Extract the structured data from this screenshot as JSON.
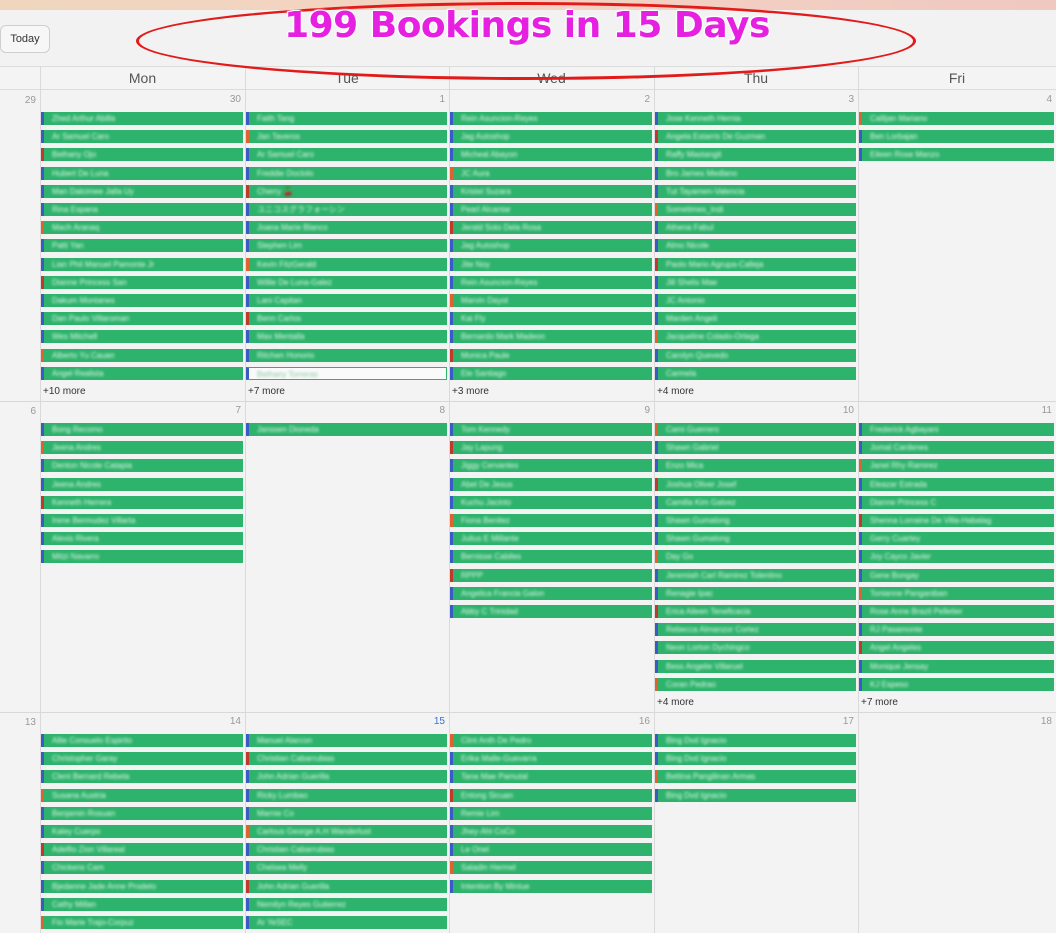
{
  "headline": "199 Bookings in 15 Days",
  "toolbar": {
    "today_label": "Today"
  },
  "weekdays": [
    "Mon",
    "Tue",
    "Wed",
    "Thu",
    "Fri"
  ],
  "colors": {
    "event_green": "#2db36b",
    "annotation_red": "#e21a1a",
    "headline_magenta": "#e620e0"
  },
  "weeks": [
    {
      "edge_day": "29",
      "days": [
        {
          "num": "30",
          "events": [
            "Zhed Arthur Abilla",
            "Ar Samuel Caro",
            "Bethany Ojo",
            "Hubert De Luna",
            "Man Dalcimee Jalla Uy",
            "Rina Espana",
            "Mach Aranaq",
            "Patti Yan",
            "Lian Phil Manuel Pamonte Jr",
            "Dianne Princess San",
            "Dakum Montanes",
            "Dan Paulo Villaroman",
            "Wes Mitchell",
            "Alberto Yu Cauan",
            "Angel Realista"
          ],
          "more": "+10 more"
        },
        {
          "num": "1",
          "events": [
            "Faith Tang",
            "Jan Taveros",
            "Ar Samuel Caro",
            "Freddie Doctolo",
            "Cherry 🍒",
            "ユニコスグラフォーシン",
            "Joana Marie Blanco",
            "Stephen Lim",
            "Kevin FitzGerald",
            "Willie De Luna-Galez",
            "Lani Capitan",
            "Benn Carlos",
            "Max Mentalla",
            "Ritchen Honorio",
            "Bethany Torreras"
          ],
          "more": "+7 more"
        },
        {
          "num": "2",
          "events": [
            "Rein Asuncion-Reyes",
            "Jag Autoshop",
            "Micheal Abayon",
            "JC Aura",
            "Kristel Suzara",
            "Pearl Alcantar",
            "Jerald Soto Dela Rosa",
            "Jag Autoshop",
            "Jite Noy",
            "Rein Asuncion-Reyes",
            "Marvin Dayot",
            "Kai Fly",
            "Bernardo Mark Madeon",
            "Monica Paule",
            "Ele Santiago"
          ],
          "more": "+3 more"
        },
        {
          "num": "3",
          "events": [
            "Jose Kenneth Hernia",
            "Angela Estarris De Guzman",
            "Raffy Mastangit",
            "Bro James Medlano",
            "Tut Tayamen-Valencia",
            "Sometimes_Indi",
            "Athena Fabul",
            "Almo Nicole",
            "Paolo Mario Agrupa-Calleja",
            "Jill Shelis Mae",
            "JC Antonio",
            "Marden Angeli",
            "Jacqueline Colado-Ortega",
            "Carolyn Quevedo",
            "Carmela"
          ],
          "more": "+4 more"
        },
        {
          "num": "4",
          "events": [
            "Callijan Mariano",
            "Ben Lorbajan",
            "Eileen Rose Manzo"
          ],
          "more": ""
        }
      ]
    },
    {
      "edge_day": "6",
      "days": [
        {
          "num": "7",
          "events": [
            "Bong Recomo",
            "Jeena Andres",
            "Denton Nicole Catapia",
            "Jeena Andres",
            "Kenneth Herrera",
            "Irene Bermudez Villarta",
            "Alexis Rivera",
            "Mitzi Navarro"
          ],
          "more": ""
        },
        {
          "num": "8",
          "events": [
            "Janssen Dioneda"
          ],
          "more": ""
        },
        {
          "num": "9",
          "events": [
            "Tom Kennedy",
            "Jay Lapung",
            "Jiggy Cervantes",
            "Abel De Jesus",
            "Kuchu Jacinto",
            "Fiona Benitez",
            "Julius E Millante",
            "Bernisse Cabiles",
            "RPPP",
            "Angelica Francia Galon",
            "Abby C Trinidad"
          ],
          "more": ""
        },
        {
          "num": "10",
          "events": [
            "Cami Guerrero",
            "Shawn Gabriel",
            "Enzo Mica",
            "Joshua Oliver Josef",
            "Camilla Kim Galvez",
            "Shawn Gumalong",
            "Shawn Gumalong",
            "Day Go",
            "Jeremiah Carl Ramirez Tolentino",
            "Renagie Ipac",
            "Erica Aileen Teneficacia",
            "Rebecca Almanzor Cortez",
            "Neon Lorton Dychingco",
            "Bess Angelie Villaruel",
            "Coran Pedrao"
          ],
          "more": "+4 more"
        },
        {
          "num": "11",
          "events": [
            "Frederick Agbayani",
            "Jomal Cardenes",
            "Janel Rhy Ramirez",
            "Eleazar Estrada",
            "Dianne Princess C",
            "Shenna Lorraine De Villa-Habalag",
            "Gerry Cuartey",
            "Joy Cayco Javier",
            "Gene Bongay",
            "Tonianne Panganiban",
            "Rose Anne Brazil Pelletier",
            "RJ Pasamonte",
            "Angel Angeles",
            "Monique Jensay",
            "KJ Espeso"
          ],
          "more": "+7 more"
        }
      ]
    },
    {
      "edge_day": "13",
      "days": [
        {
          "num": "14",
          "events": [
            "Allie Consuelo Espirito",
            "Christopher Garay",
            "Clent Bernard Rebeta",
            "Susana Austria",
            "Benjamin Rosuan",
            "Kaley Cuerpo",
            "Adelfio Zion Villareal",
            "Chickens Cam",
            "Bjedanne Jade Anne Prodeto",
            "Cathy Millan",
            "Fio Marie Trajo-Corpuz"
          ],
          "more": ""
        },
        {
          "num": "15",
          "events": [
            "Manuel Alarcon",
            "Christian Cabarrubias",
            "John Adrian Guerilla",
            "Ricky Lumbao",
            "Marnie Co",
            "Carlous George A.H Wanderlust",
            "Christian Cabarrubias",
            "Chelsea Melly",
            "John Adrian Guerilla",
            "Nemilyn Reyes Gutierrez",
            "Ar YeSEC"
          ],
          "more": ""
        },
        {
          "num": "16",
          "events": [
            "Clint Anth De Pedro",
            "Erika Malle-Guevarra",
            "Tana Mae Pamutal",
            "Entong Sicuan",
            "Remie Lim",
            "Jhey-Ahl CoCo",
            "Le Onel",
            "Saladin Hermel",
            "Intention By Mintue"
          ],
          "more": ""
        },
        {
          "num": "17",
          "events": [
            "Bing Dvd Ignacio",
            "Bing Dvd Ignacio",
            "Bettina Pangilinan Armas",
            "Bing Dvd Ignacio"
          ],
          "more": ""
        },
        {
          "num": "18",
          "events": [],
          "more": ""
        }
      ]
    }
  ]
}
